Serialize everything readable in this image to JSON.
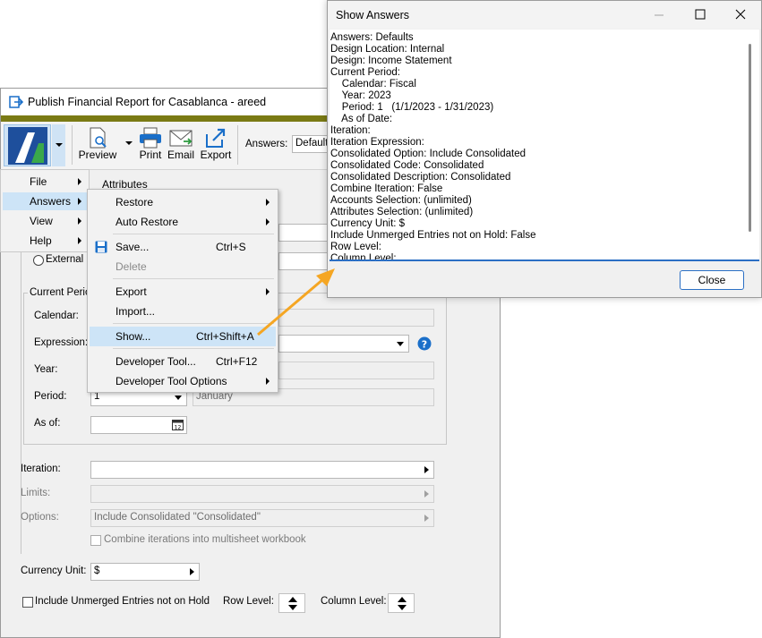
{
  "main_window": {
    "title": "Publish Financial Report for Casablanca - areed",
    "toolbar": {
      "preview": "Preview",
      "print": "Print",
      "email": "Email",
      "export": "Export",
      "answers_label": "Answers:",
      "answers_value": "Defaults"
    },
    "tab_attributes": "Attributes",
    "external_label": "External",
    "current_period_group": "Current Perio",
    "calendar_label": "Calendar:",
    "expression_label": "Expression:",
    "year_label": "Year:",
    "period_label": "Period:",
    "period_value": "1",
    "period_name": "January",
    "as_of_label": "As of:",
    "iteration_label": "Iteration:",
    "limits_label": "Limits:",
    "options_label": "Options:",
    "options_value": "Include Consolidated \"Consolidated\"",
    "combine_label": "Combine iterations into multisheet workbook",
    "currency_label": "Currency Unit:",
    "currency_value": "$",
    "include_unmerged_label": "Include Unmerged Entries not on Hold",
    "row_level_label": "Row Level:",
    "column_level_label": "Column Level:"
  },
  "app_menu": {
    "items": [
      {
        "label": "File"
      },
      {
        "label": "Answers"
      },
      {
        "label": "View"
      },
      {
        "label": "Help"
      }
    ]
  },
  "answers_menu": {
    "restore": "Restore",
    "auto_restore": "Auto Restore",
    "save": "Save...",
    "save_shortcut": "Ctrl+S",
    "delete": "Delete",
    "export": "Export",
    "import": "Import...",
    "show": "Show...",
    "show_shortcut": "Ctrl+Shift+A",
    "developer_tool": "Developer Tool...",
    "developer_tool_shortcut": "Ctrl+F12",
    "developer_tool_options": "Developer Tool Options"
  },
  "show_answers": {
    "title": "Show Answers",
    "close_button": "Close",
    "lines": [
      "Answers: Defaults",
      "Design Location: Internal",
      "Design: Income Statement",
      "Current Period:",
      "    Calendar: Fiscal",
      "    Year: 2023",
      "    Period: 1   (1/1/2023 - 1/31/2023)",
      "    As of Date:",
      "Iteration:",
      "Iteration Expression:",
      "Consolidated Option: Include Consolidated",
      "Consolidated Code: Consolidated",
      "Consolidated Description: Consolidated",
      "Combine Iteration: False",
      "Accounts Selection: (unlimited)",
      "Attributes Selection: (unlimited)",
      "Currency Unit: $",
      "Include Unmerged Entries not on Hold: False",
      "Row Level:",
      "Column Level:"
    ]
  },
  "colors": {
    "accent_bar": "#7a7a14",
    "selection": "#cde4f7",
    "callout_arrow": "#f5a623",
    "focus_blue": "#2b6fc4"
  }
}
